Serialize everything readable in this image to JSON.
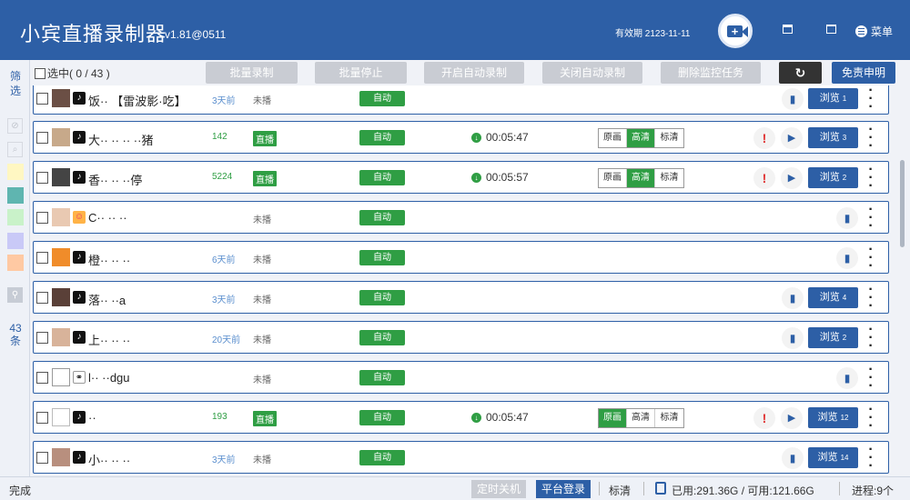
{
  "header": {
    "title": "小宾直播录制器",
    "version": "v1.81@0511",
    "validity": "有效期 2123-11-11",
    "menu_label": "菜单"
  },
  "sidebar": {
    "filter_label": "筛选",
    "count_label": "43条",
    "swatch_colors": [
      "#fff7c2",
      "#5fb5b0",
      "#c9f2c9",
      "#c9c9f7",
      "#ffc9a3"
    ]
  },
  "toolbar": {
    "select_all": "选中( 0 / 43 )",
    "buttons": [
      "批量录制",
      "批量停止",
      "开启自动录制",
      "关闭自动录制",
      "删除监控任务"
    ],
    "disclaimer": "免责申明"
  },
  "rows": [
    {
      "name": "饭·· 【雷波影·吃】",
      "meta": "3天前",
      "meta_type": "time",
      "status": "未播",
      "auto": "自动",
      "browse": "浏览",
      "browse_n": "1"
    },
    {
      "name": "大·· ·· ·· ··猪",
      "meta": "142",
      "meta_type": "viewers",
      "status": "直播",
      "auto": "自动",
      "timer": "00:05:47",
      "quality": [
        "原画",
        "高清",
        "标清"
      ],
      "quality_on": 1,
      "browse": "浏览",
      "browse_n": "3"
    },
    {
      "name": "香·· ·· ··停",
      "meta": "5224",
      "meta_type": "viewers",
      "status": "直播",
      "auto": "自动",
      "timer": "00:05:57",
      "quality": [
        "原画",
        "高清",
        "标清"
      ],
      "quality_on": 1,
      "browse": "浏览",
      "browse_n": "2"
    },
    {
      "name": "C·· ·· ··",
      "meta": "",
      "meta_type": "time",
      "status": "未播",
      "auto": "自动"
    },
    {
      "name": "橙·· ·· ··",
      "meta": "6天前",
      "meta_type": "time",
      "status": "未播",
      "auto": "自动"
    },
    {
      "name": "落·· ··a",
      "meta": "3天前",
      "meta_type": "time",
      "status": "未播",
      "auto": "自动",
      "browse": "浏览",
      "browse_n": "4"
    },
    {
      "name": "上·· ·· ··",
      "meta": "20天前",
      "meta_type": "time",
      "status": "未播",
      "auto": "自动",
      "browse": "浏览",
      "browse_n": "2"
    },
    {
      "name": "l·· ··dgu",
      "meta": "",
      "meta_type": "time",
      "status": "未播",
      "auto": "自动"
    },
    {
      "name": "··",
      "meta": "193",
      "meta_type": "viewers",
      "status": "直播",
      "auto": "自动",
      "timer": "00:05:47",
      "quality": [
        "原画",
        "高清",
        "标清"
      ],
      "quality_on": 0,
      "browse": "浏览",
      "browse_n": "12"
    },
    {
      "name": "小·· ·· ··",
      "meta": "3天前",
      "meta_type": "time",
      "status": "未播",
      "auto": "自动",
      "browse": "浏览",
      "browse_n": "14"
    }
  ],
  "statusbar": {
    "done": "完成",
    "shutdown": "定时关机",
    "platform_login": "平台登录",
    "quality": "标清",
    "disk": "已用:291.36G / 可用:121.66G",
    "process": "进程:9个"
  },
  "colors": {
    "primary": "#2d5fa6",
    "green": "#2f9e44",
    "grey_button": "#c9ccd3"
  }
}
